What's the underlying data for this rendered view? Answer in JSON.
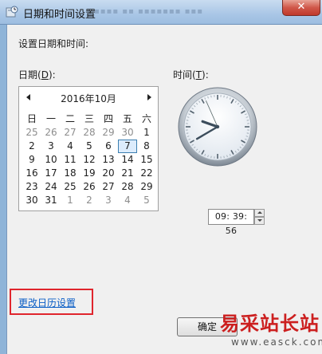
{
  "window": {
    "title": "日期和时间设置",
    "close_glyph": "✕"
  },
  "heading": "设置日期和时间:",
  "date_label": {
    "prefix": "日期(",
    "accel": "D",
    "suffix": "):"
  },
  "time_label": {
    "prefix": "时间(",
    "accel": "T",
    "suffix": "):"
  },
  "calendar": {
    "month_title": "2016年10月",
    "weekdays": [
      "日",
      "一",
      "二",
      "三",
      "四",
      "五",
      "六"
    ],
    "weeks": [
      [
        {
          "d": "25",
          "cur": false
        },
        {
          "d": "26",
          "cur": false
        },
        {
          "d": "27",
          "cur": false
        },
        {
          "d": "28",
          "cur": false
        },
        {
          "d": "29",
          "cur": false
        },
        {
          "d": "30",
          "cur": false
        },
        {
          "d": "1",
          "cur": true
        }
      ],
      [
        {
          "d": "2",
          "cur": true
        },
        {
          "d": "3",
          "cur": true
        },
        {
          "d": "4",
          "cur": true
        },
        {
          "d": "5",
          "cur": true
        },
        {
          "d": "6",
          "cur": true
        },
        {
          "d": "7",
          "cur": true,
          "selected": true
        },
        {
          "d": "8",
          "cur": true
        }
      ],
      [
        {
          "d": "9",
          "cur": true
        },
        {
          "d": "10",
          "cur": true
        },
        {
          "d": "11",
          "cur": true
        },
        {
          "d": "12",
          "cur": true
        },
        {
          "d": "13",
          "cur": true
        },
        {
          "d": "14",
          "cur": true
        },
        {
          "d": "15",
          "cur": true
        }
      ],
      [
        {
          "d": "16",
          "cur": true
        },
        {
          "d": "17",
          "cur": true
        },
        {
          "d": "18",
          "cur": true
        },
        {
          "d": "19",
          "cur": true
        },
        {
          "d": "20",
          "cur": true
        },
        {
          "d": "21",
          "cur": true
        },
        {
          "d": "22",
          "cur": true
        }
      ],
      [
        {
          "d": "23",
          "cur": true
        },
        {
          "d": "24",
          "cur": true
        },
        {
          "d": "25",
          "cur": true
        },
        {
          "d": "26",
          "cur": true
        },
        {
          "d": "27",
          "cur": true
        },
        {
          "d": "28",
          "cur": true
        },
        {
          "d": "29",
          "cur": true
        }
      ],
      [
        {
          "d": "30",
          "cur": true
        },
        {
          "d": "31",
          "cur": true
        },
        {
          "d": "1",
          "cur": false
        },
        {
          "d": "2",
          "cur": false
        },
        {
          "d": "3",
          "cur": false
        },
        {
          "d": "4",
          "cur": false
        },
        {
          "d": "5",
          "cur": false
        }
      ]
    ],
    "selected_color": "#3c7fb1"
  },
  "clock": {
    "hours": 9,
    "minutes": 39,
    "seconds": 56
  },
  "time_value": "09: 39: 56",
  "link_text": "更改日历设置",
  "ok_label": "确定",
  "watermark": {
    "title": "易采站长站",
    "url": "www.easck.com"
  },
  "colors": {
    "highlight": "#e0252d",
    "link": "#0c5fc6"
  }
}
